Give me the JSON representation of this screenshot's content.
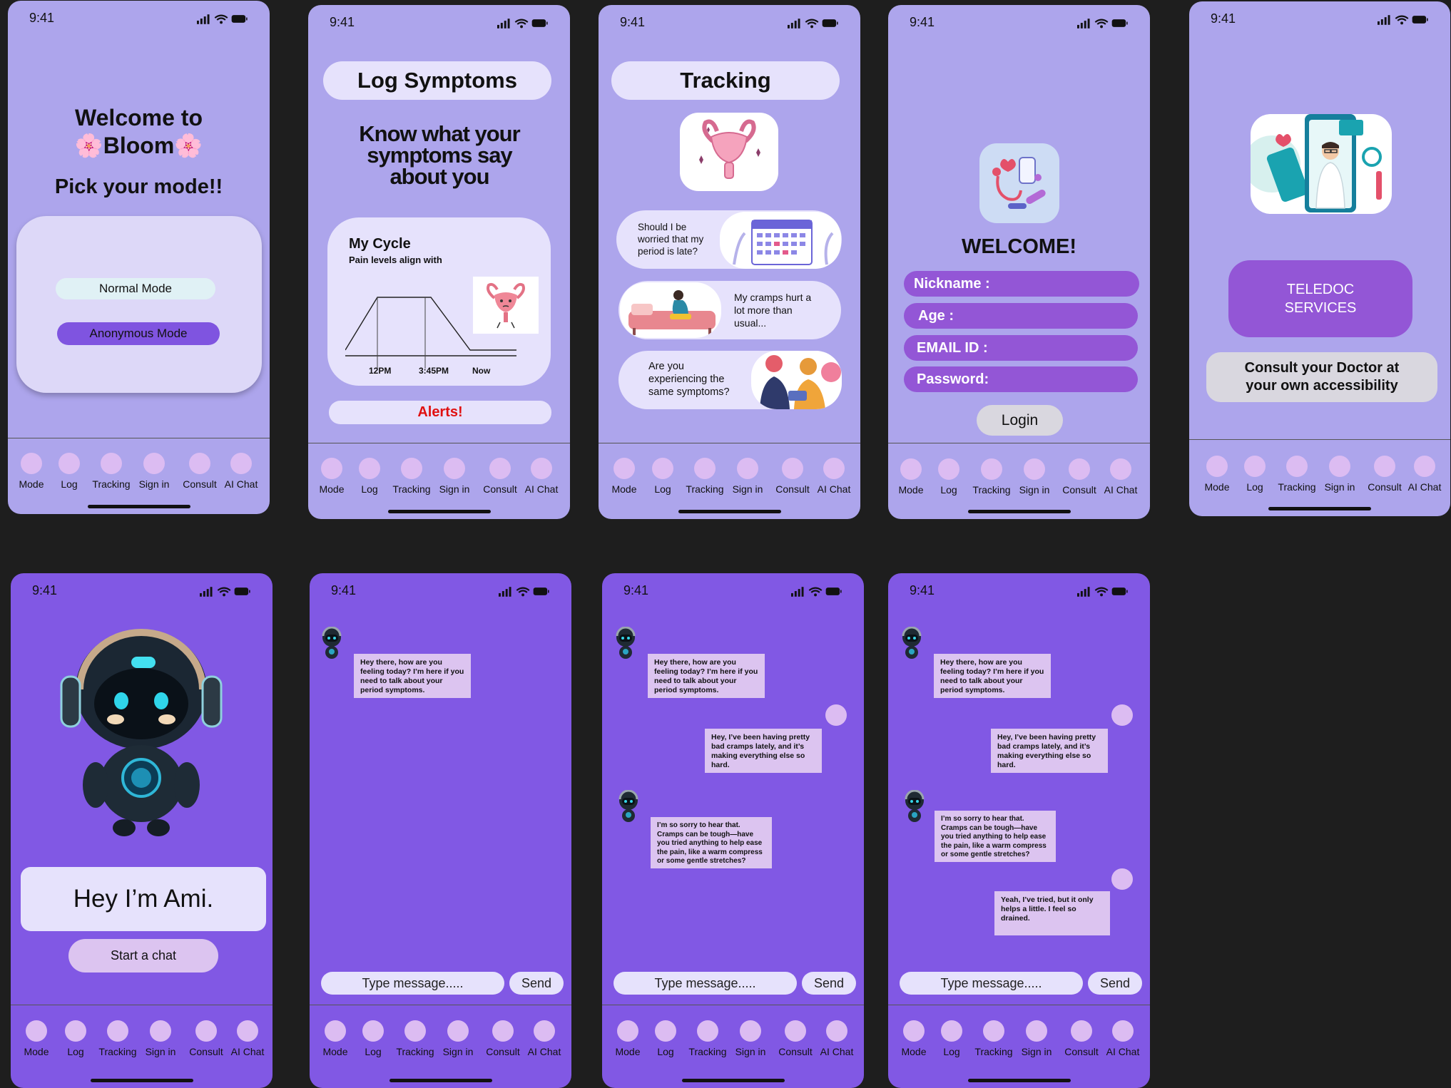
{
  "status_time": "9:41",
  "nav": [
    "Mode",
    "Log",
    "Tracking",
    "Sign in",
    "Consult",
    "AI Chat"
  ],
  "mode_screen": {
    "welcome_line1": "Welcome to",
    "welcome_line2": "🌸Bloom🌸",
    "pick": "Pick your mode!!",
    "normal": "Normal Mode",
    "anonymous": "Anonymous Mode"
  },
  "log_screen": {
    "title": "Log Symptoms",
    "headline": "Know what your symptoms say about you",
    "cycle_title": "My Cycle",
    "cycle_sub": "Pain levels align with",
    "ticks": [
      "12PM",
      "3:45PM",
      "Now"
    ],
    "alerts": "Alerts!"
  },
  "tracking_screen": {
    "title": "Tracking",
    "q1": "Should I be worried that my period is late?",
    "q2": "My cramps hurt a lot more than usual...",
    "q3": "Are you experiencing the same symptoms?"
  },
  "signin_screen": {
    "welcome": "WELCOME!",
    "nickname": "Nickname :",
    "age": "Age :",
    "email": "EMAIL ID :",
    "password": "Password:",
    "login": "Login"
  },
  "consult_screen": {
    "teledoc": "TELEDOC SERVICES",
    "consult": "Consult your Doctor at your own accessibility"
  },
  "ami_screen": {
    "hello": "Hey I’m Ami.",
    "start": "Start a chat"
  },
  "chat": {
    "bot1": "Hey there, how are you feeling today? I’m here if you need to talk about your period symptoms.",
    "user1": "Hey, I’ve been having pretty bad cramps lately, and it’s making everything else so hard.",
    "bot2": "I’m so sorry to hear that. Cramps can be tough—have you tried anything to help ease the pain, like a warm compress or some gentle stretches?",
    "user2": "Yeah, I’ve tried, but it only helps a little. I feel so drained.",
    "placeholder": "Type message.....",
    "send": "Send"
  },
  "colors": {
    "lavender_bg": "#ada5ec",
    "purple_bg": "#8158e4",
    "card": "#e6e2fc",
    "nav_dot": "#dcbcf2",
    "field": "#9356d6",
    "alert_red": "#e01010"
  }
}
